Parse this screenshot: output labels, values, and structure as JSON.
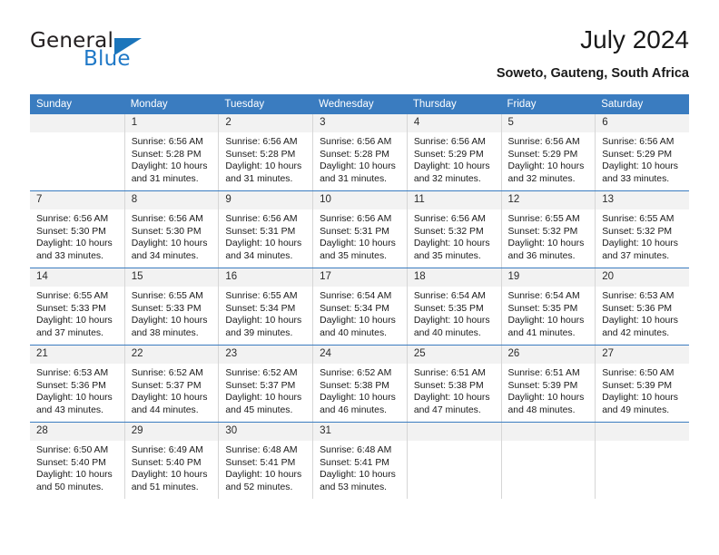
{
  "logo": {
    "word_top": "General",
    "word_bottom": "Blue",
    "accent_color": "#1b75bb"
  },
  "header": {
    "title": "July 2024",
    "subtitle": "Soweto, Gauteng, South Africa"
  },
  "calendar": {
    "header_color": "#3a7cc0",
    "daynum_bg": "#f2f2f2",
    "weekdays": [
      "Sunday",
      "Monday",
      "Tuesday",
      "Wednesday",
      "Thursday",
      "Friday",
      "Saturday"
    ],
    "labels": {
      "sunrise": "Sunrise:",
      "sunset": "Sunset:",
      "daylight": "Daylight:"
    },
    "weeks": [
      [
        {
          "day": "",
          "sunrise": "",
          "sunset": "",
          "daylight_line1": "",
          "daylight_line2": ""
        },
        {
          "day": "1",
          "sunrise": "Sunrise: 6:56 AM",
          "sunset": "Sunset: 5:28 PM",
          "daylight_line1": "Daylight: 10 hours",
          "daylight_line2": "and 31 minutes."
        },
        {
          "day": "2",
          "sunrise": "Sunrise: 6:56 AM",
          "sunset": "Sunset: 5:28 PM",
          "daylight_line1": "Daylight: 10 hours",
          "daylight_line2": "and 31 minutes."
        },
        {
          "day": "3",
          "sunrise": "Sunrise: 6:56 AM",
          "sunset": "Sunset: 5:28 PM",
          "daylight_line1": "Daylight: 10 hours",
          "daylight_line2": "and 31 minutes."
        },
        {
          "day": "4",
          "sunrise": "Sunrise: 6:56 AM",
          "sunset": "Sunset: 5:29 PM",
          "daylight_line1": "Daylight: 10 hours",
          "daylight_line2": "and 32 minutes."
        },
        {
          "day": "5",
          "sunrise": "Sunrise: 6:56 AM",
          "sunset": "Sunset: 5:29 PM",
          "daylight_line1": "Daylight: 10 hours",
          "daylight_line2": "and 32 minutes."
        },
        {
          "day": "6",
          "sunrise": "Sunrise: 6:56 AM",
          "sunset": "Sunset: 5:29 PM",
          "daylight_line1": "Daylight: 10 hours",
          "daylight_line2": "and 33 minutes."
        }
      ],
      [
        {
          "day": "7",
          "sunrise": "Sunrise: 6:56 AM",
          "sunset": "Sunset: 5:30 PM",
          "daylight_line1": "Daylight: 10 hours",
          "daylight_line2": "and 33 minutes."
        },
        {
          "day": "8",
          "sunrise": "Sunrise: 6:56 AM",
          "sunset": "Sunset: 5:30 PM",
          "daylight_line1": "Daylight: 10 hours",
          "daylight_line2": "and 34 minutes."
        },
        {
          "day": "9",
          "sunrise": "Sunrise: 6:56 AM",
          "sunset": "Sunset: 5:31 PM",
          "daylight_line1": "Daylight: 10 hours",
          "daylight_line2": "and 34 minutes."
        },
        {
          "day": "10",
          "sunrise": "Sunrise: 6:56 AM",
          "sunset": "Sunset: 5:31 PM",
          "daylight_line1": "Daylight: 10 hours",
          "daylight_line2": "and 35 minutes."
        },
        {
          "day": "11",
          "sunrise": "Sunrise: 6:56 AM",
          "sunset": "Sunset: 5:32 PM",
          "daylight_line1": "Daylight: 10 hours",
          "daylight_line2": "and 35 minutes."
        },
        {
          "day": "12",
          "sunrise": "Sunrise: 6:55 AM",
          "sunset": "Sunset: 5:32 PM",
          "daylight_line1": "Daylight: 10 hours",
          "daylight_line2": "and 36 minutes."
        },
        {
          "day": "13",
          "sunrise": "Sunrise: 6:55 AM",
          "sunset": "Sunset: 5:32 PM",
          "daylight_line1": "Daylight: 10 hours",
          "daylight_line2": "and 37 minutes."
        }
      ],
      [
        {
          "day": "14",
          "sunrise": "Sunrise: 6:55 AM",
          "sunset": "Sunset: 5:33 PM",
          "daylight_line1": "Daylight: 10 hours",
          "daylight_line2": "and 37 minutes."
        },
        {
          "day": "15",
          "sunrise": "Sunrise: 6:55 AM",
          "sunset": "Sunset: 5:33 PM",
          "daylight_line1": "Daylight: 10 hours",
          "daylight_line2": "and 38 minutes."
        },
        {
          "day": "16",
          "sunrise": "Sunrise: 6:55 AM",
          "sunset": "Sunset: 5:34 PM",
          "daylight_line1": "Daylight: 10 hours",
          "daylight_line2": "and 39 minutes."
        },
        {
          "day": "17",
          "sunrise": "Sunrise: 6:54 AM",
          "sunset": "Sunset: 5:34 PM",
          "daylight_line1": "Daylight: 10 hours",
          "daylight_line2": "and 40 minutes."
        },
        {
          "day": "18",
          "sunrise": "Sunrise: 6:54 AM",
          "sunset": "Sunset: 5:35 PM",
          "daylight_line1": "Daylight: 10 hours",
          "daylight_line2": "and 40 minutes."
        },
        {
          "day": "19",
          "sunrise": "Sunrise: 6:54 AM",
          "sunset": "Sunset: 5:35 PM",
          "daylight_line1": "Daylight: 10 hours",
          "daylight_line2": "and 41 minutes."
        },
        {
          "day": "20",
          "sunrise": "Sunrise: 6:53 AM",
          "sunset": "Sunset: 5:36 PM",
          "daylight_line1": "Daylight: 10 hours",
          "daylight_line2": "and 42 minutes."
        }
      ],
      [
        {
          "day": "21",
          "sunrise": "Sunrise: 6:53 AM",
          "sunset": "Sunset: 5:36 PM",
          "daylight_line1": "Daylight: 10 hours",
          "daylight_line2": "and 43 minutes."
        },
        {
          "day": "22",
          "sunrise": "Sunrise: 6:52 AM",
          "sunset": "Sunset: 5:37 PM",
          "daylight_line1": "Daylight: 10 hours",
          "daylight_line2": "and 44 minutes."
        },
        {
          "day": "23",
          "sunrise": "Sunrise: 6:52 AM",
          "sunset": "Sunset: 5:37 PM",
          "daylight_line1": "Daylight: 10 hours",
          "daylight_line2": "and 45 minutes."
        },
        {
          "day": "24",
          "sunrise": "Sunrise: 6:52 AM",
          "sunset": "Sunset: 5:38 PM",
          "daylight_line1": "Daylight: 10 hours",
          "daylight_line2": "and 46 minutes."
        },
        {
          "day": "25",
          "sunrise": "Sunrise: 6:51 AM",
          "sunset": "Sunset: 5:38 PM",
          "daylight_line1": "Daylight: 10 hours",
          "daylight_line2": "and 47 minutes."
        },
        {
          "day": "26",
          "sunrise": "Sunrise: 6:51 AM",
          "sunset": "Sunset: 5:39 PM",
          "daylight_line1": "Daylight: 10 hours",
          "daylight_line2": "and 48 minutes."
        },
        {
          "day": "27",
          "sunrise": "Sunrise: 6:50 AM",
          "sunset": "Sunset: 5:39 PM",
          "daylight_line1": "Daylight: 10 hours",
          "daylight_line2": "and 49 minutes."
        }
      ],
      [
        {
          "day": "28",
          "sunrise": "Sunrise: 6:50 AM",
          "sunset": "Sunset: 5:40 PM",
          "daylight_line1": "Daylight: 10 hours",
          "daylight_line2": "and 50 minutes."
        },
        {
          "day": "29",
          "sunrise": "Sunrise: 6:49 AM",
          "sunset": "Sunset: 5:40 PM",
          "daylight_line1": "Daylight: 10 hours",
          "daylight_line2": "and 51 minutes."
        },
        {
          "day": "30",
          "sunrise": "Sunrise: 6:48 AM",
          "sunset": "Sunset: 5:41 PM",
          "daylight_line1": "Daylight: 10 hours",
          "daylight_line2": "and 52 minutes."
        },
        {
          "day": "31",
          "sunrise": "Sunrise: 6:48 AM",
          "sunset": "Sunset: 5:41 PM",
          "daylight_line1": "Daylight: 10 hours",
          "daylight_line2": "and 53 minutes."
        },
        {
          "day": "",
          "sunrise": "",
          "sunset": "",
          "daylight_line1": "",
          "daylight_line2": ""
        },
        {
          "day": "",
          "sunrise": "",
          "sunset": "",
          "daylight_line1": "",
          "daylight_line2": ""
        },
        {
          "day": "",
          "sunrise": "",
          "sunset": "",
          "daylight_line1": "",
          "daylight_line2": ""
        }
      ]
    ]
  }
}
